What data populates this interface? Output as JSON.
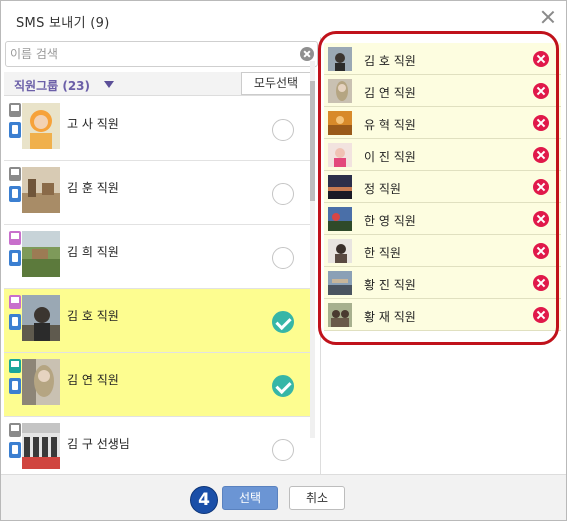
{
  "dialog": {
    "title": "SMS 보내기 (9)"
  },
  "search": {
    "placeholder": "이름 검색",
    "value": ""
  },
  "group": {
    "label": "직원그룹 (23)",
    "select_all_label": "모두선택"
  },
  "employees": [
    {
      "name": "고 사 직원",
      "pc_color": "gray",
      "selected": false
    },
    {
      "name": "김 훈 직원",
      "pc_color": "gray",
      "selected": false
    },
    {
      "name": "김 희 직원",
      "pc_color": "pink",
      "selected": false
    },
    {
      "name": "김 호 직원",
      "pc_color": "pink",
      "selected": true
    },
    {
      "name": "김 연 직원",
      "pc_color": "teal",
      "selected": true
    },
    {
      "name": "김 구 선생님",
      "pc_color": "gray",
      "selected": false
    }
  ],
  "selected_recipients": [
    {
      "name": "김 호 직원"
    },
    {
      "name": "김 연 직원"
    },
    {
      "name": "유 혁 직원"
    },
    {
      "name": "이 진 직원"
    },
    {
      "name": "정 직원"
    },
    {
      "name": "한 영 직원"
    },
    {
      "name": "한 직원"
    },
    {
      "name": "황 진 직원"
    },
    {
      "name": "황 재 직원"
    }
  ],
  "footer": {
    "step_number": "4",
    "ok_label": "선택",
    "cancel_label": "취소"
  },
  "colors": {
    "selected_row_bg": "#fdfd90",
    "check_on": "#36b6a7",
    "remove": "#e0194a",
    "highlight_border": "#c0121b",
    "ok_button": "#6b95d4",
    "step_badge": "#1a4fa8"
  }
}
